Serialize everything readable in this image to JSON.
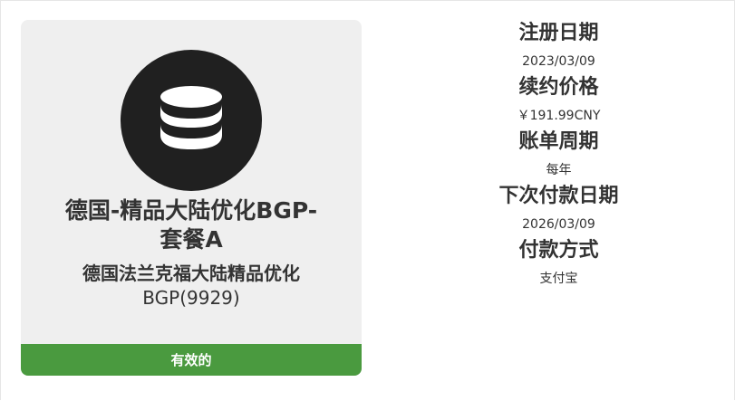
{
  "product": {
    "icon": "database-icon",
    "title_line1": "德国-精品大陆优化BGP-",
    "title_line2": "套餐A",
    "subtitle_line1": "德国法兰克福大陆精品优化",
    "subtitle_line2": "BGP(9929)",
    "status": "有效的",
    "status_color": "#4a9a3f"
  },
  "details": [
    {
      "label": "注册日期",
      "value": "2023/03/09"
    },
    {
      "label": "续约价格",
      "value": "￥191.99CNY"
    },
    {
      "label": "账单周期",
      "value": "每年"
    },
    {
      "label": "下次付款日期",
      "value": "2026/03/09"
    },
    {
      "label": "付款方式",
      "value": "支付宝"
    }
  ]
}
